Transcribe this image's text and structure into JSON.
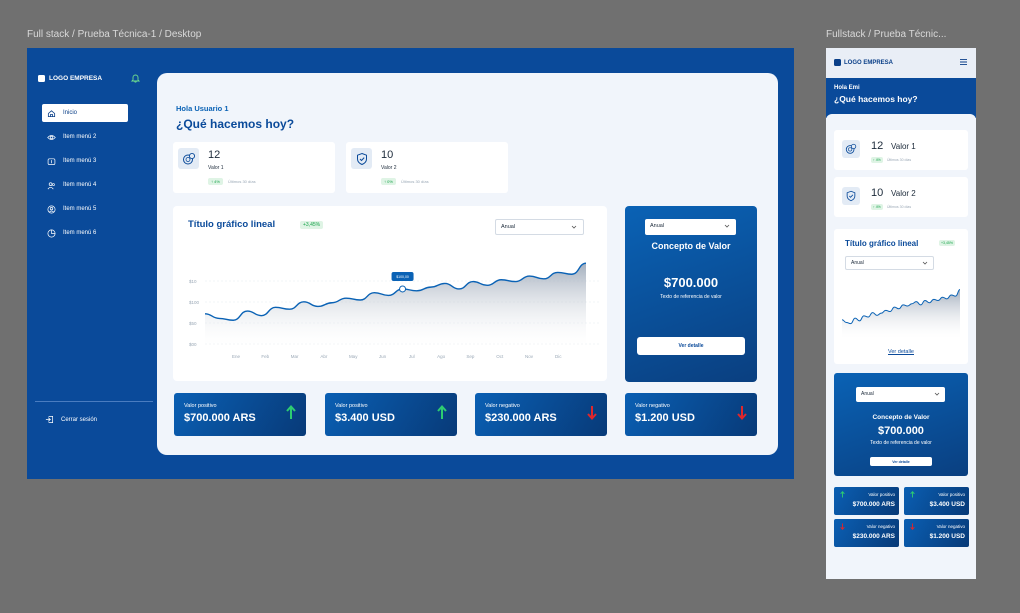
{
  "frames": {
    "desktop_label": "Full stack / Prueba Técnica-1 / Desktop",
    "mobile_label": "Fullstack / Prueba Técnic..."
  },
  "brand": {
    "logo_text": "LOGO EMPRESA",
    "primary": "#0a4a9a",
    "accent_positive": "#17a34a",
    "accent_negative": "#e0262b"
  },
  "sidebar": {
    "items": [
      {
        "label": "Inicio",
        "icon": "home-icon",
        "active": true
      },
      {
        "label": "Item menú 2",
        "icon": "eye-icon",
        "active": false
      },
      {
        "label": "Item menú 3",
        "icon": "wallet-icon",
        "active": false
      },
      {
        "label": "Item menú 4",
        "icon": "users-icon",
        "active": false
      },
      {
        "label": "Item menú 5",
        "icon": "user-circle-icon",
        "active": false
      },
      {
        "label": "Item menú 6",
        "icon": "pie-chart-icon",
        "active": false
      }
    ],
    "logout": "Cerrar sesión"
  },
  "header": {
    "greeting": "Hola Usuario 1",
    "question": "¿Qué hacemos hoy?"
  },
  "kpis": [
    {
      "value": "12",
      "label": "Valor 1",
      "delta": "↑ 4%",
      "note": "Últimos 30 días"
    },
    {
      "value": "10",
      "label": "Valor 2",
      "delta": "↑ 0%",
      "note": "Últimos 30 días"
    }
  ],
  "chart_data": {
    "type": "area",
    "title": "Título gráfico lineal",
    "badge": "+3,45%",
    "period_select": "Anual",
    "tooltip": "$100,00",
    "x": [
      "Ene",
      "Feb",
      "Mar",
      "Abr",
      "May",
      "Jun",
      "Jul",
      "Ago",
      "Sep",
      "Oct",
      "Nov",
      "Dic"
    ],
    "y_ticks": [
      "$10",
      "$100",
      "$50",
      "$00"
    ],
    "series": [
      {
        "values": [
          0.35,
          0.3,
          0.28,
          0.38,
          0.33,
          0.42,
          0.4,
          0.48,
          0.43,
          0.47,
          0.52,
          0.5,
          0.58,
          0.55,
          0.62,
          0.6,
          0.64,
          0.68,
          0.62,
          0.7,
          0.66,
          0.72,
          0.7,
          0.76,
          0.73,
          0.8,
          0.78,
          0.9
        ]
      }
    ]
  },
  "concept": {
    "select": "Anual",
    "title": "Concepto de Valor",
    "value": "$700.000",
    "subtitle": "Texto de referencia de valor",
    "button": "Ver detalle"
  },
  "stats": [
    {
      "label": "Valor positivo",
      "value": "$700.000 ARS",
      "trend": "up"
    },
    {
      "label": "Valor positivo",
      "value": "$3.400 USD",
      "trend": "up"
    },
    {
      "label": "Valor negativo",
      "value": "$230.000 ARS",
      "trend": "down"
    },
    {
      "label": "Valor negativo",
      "value": "$1.200 USD",
      "trend": "down"
    }
  ],
  "mobile": {
    "greeting": "Hola Emi",
    "question": "¿Qué hacemos hoy?",
    "kpis": [
      {
        "value": "12",
        "label": "Valor 1",
        "delta": "↑ 4%",
        "note": "Últimos 30 días"
      },
      {
        "value": "10",
        "label": "Valor 2",
        "delta": "↑ 4%",
        "note": "Últimos 30 días"
      }
    ],
    "chart_title": "Título gráfico lineal",
    "chart_badge": "+3,45%",
    "chart_select": "Anual",
    "chart_link": "Ver detalle",
    "concept": {
      "select": "Anual",
      "title": "Concepto de Valor",
      "value": "$700.000",
      "subtitle": "Texto de referencia de valor",
      "button": "Ver detalle"
    },
    "stats": [
      {
        "label": "Valor positivo",
        "value": "$700.000 ARS",
        "trend": "up"
      },
      {
        "label": "Valor positivo",
        "value": "$3.400 USD",
        "trend": "up"
      },
      {
        "label": "Valor negativo",
        "value": "$230.000 ARS",
        "trend": "down"
      },
      {
        "label": "Valor negativo",
        "value": "$1.200 USD",
        "trend": "down"
      }
    ]
  }
}
